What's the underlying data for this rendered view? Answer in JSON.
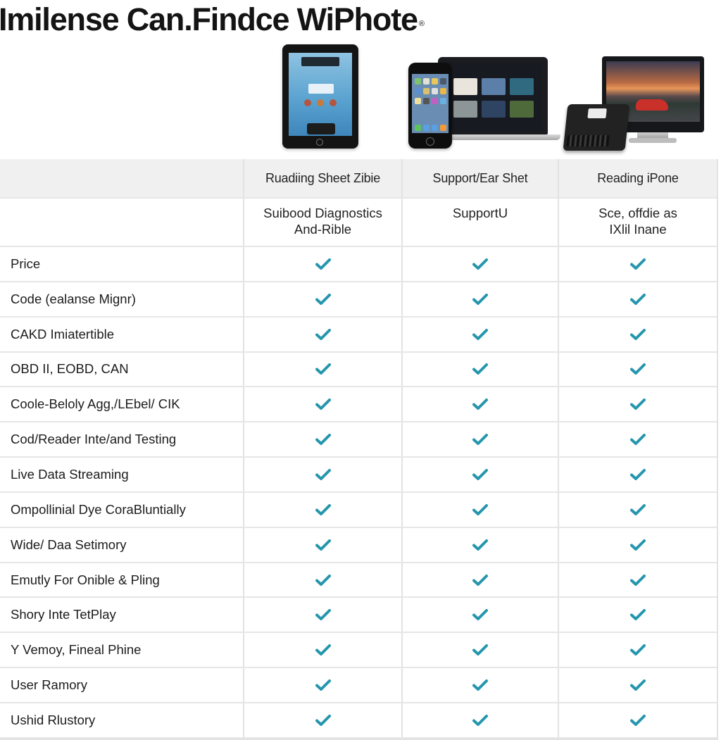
{
  "header": {
    "title": "Imilense Can.Findce WiPhote",
    "title_mark": "®"
  },
  "images": [
    {
      "name": "tablet",
      "description": "black tablet showing blue app home screen"
    },
    {
      "name": "smartphone",
      "description": "black smartphone with app icons"
    },
    {
      "name": "laptop",
      "description": "laptop showing media tiles"
    },
    {
      "name": "monitor",
      "description": "desktop monitor showing red car at mountain sunset"
    },
    {
      "name": "obd-adapter",
      "description": "black OBD adapter device"
    }
  ],
  "table": {
    "columns": [
      {
        "header": "",
        "subheader": ""
      },
      {
        "header": "Ruadiing Sheet Zibie",
        "subheader": "Suibood Diagnostics\nAnd-Rible"
      },
      {
        "header": "Support/Ear Shet",
        "subheader": "SupportU"
      },
      {
        "header": "Reading iPone",
        "subheader": "Sce, offdie as\nIXlil Inane"
      }
    ],
    "check_color": "#2596ad",
    "rows": [
      {
        "feature": "Price",
        "values": [
          "check",
          "check",
          "check"
        ]
      },
      {
        "feature": "Code (ealanse Mignr)",
        "values": [
          "check",
          "check",
          "check"
        ]
      },
      {
        "feature": "CAKD Imiatertible",
        "values": [
          "check",
          "check",
          "check"
        ]
      },
      {
        "feature": "OBD II, EOBD, CAN",
        "values": [
          "check",
          "check",
          "check"
        ]
      },
      {
        "feature": "Coole-Beloly Agg,/LEbel/ CIK",
        "values": [
          "check",
          "check",
          "check"
        ]
      },
      {
        "feature": "Cod/Reader Inte/and Testing",
        "values": [
          "check",
          "check",
          "check"
        ]
      },
      {
        "feature": "Live Data Streaming",
        "values": [
          "check",
          "check",
          "check"
        ]
      },
      {
        "feature": "Ompollinial Dye CoraBluntially",
        "values": [
          "check",
          "check",
          "check"
        ]
      },
      {
        "feature": "Wide/ Daa Setimory",
        "values": [
          "check",
          "check",
          "check"
        ]
      },
      {
        "feature": "Emutly For Onible & Pling",
        "values": [
          "check",
          "check",
          "check"
        ]
      },
      {
        "feature": "Shory Inte TetPlay",
        "values": [
          "check",
          "check",
          "check"
        ]
      },
      {
        "feature": "Y Vemoy, Fineal Phine",
        "values": [
          "check",
          "check",
          "check"
        ]
      },
      {
        "feature": "User Ramory",
        "values": [
          "check",
          "check",
          "check"
        ]
      },
      {
        "feature": "Ushid Rlustory",
        "values": [
          "check",
          "check",
          "check"
        ]
      }
    ]
  }
}
